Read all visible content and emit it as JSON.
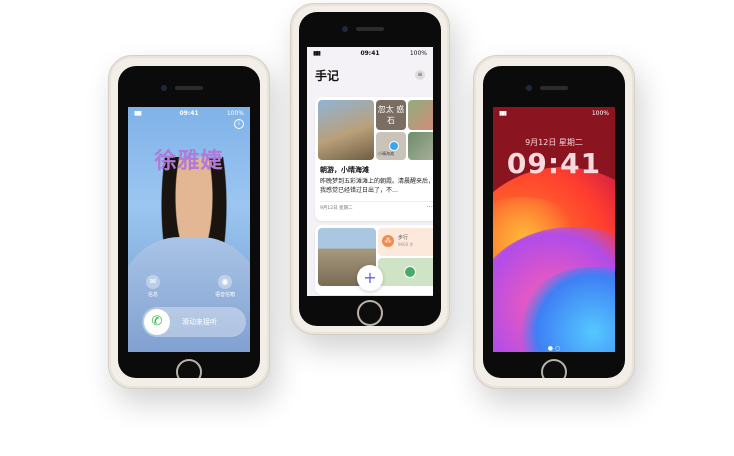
{
  "phone1": {
    "status": {
      "time": "09:41",
      "battery": "100%"
    },
    "contact_name": "徐雅婕",
    "message_label": "信息",
    "voicemail_label": "语音信箱",
    "slider_label": "滑动来接听"
  },
  "phone2": {
    "status": {
      "time": "09:41",
      "battery": "100%"
    },
    "title": "手记",
    "overlay_text": "忽太 惑石",
    "pin_label": "小晴海滩",
    "entry_title": "朝游，小晴海滩",
    "entry_body": "昨晚梦到五彩滩滩上的朝霞。清晨醒来后，我感觉已经错过日出了，不…",
    "entry_date": "9月12日 星期二",
    "walk_label": "步行",
    "walk_value": "9660 步"
  },
  "phone3": {
    "status": {
      "battery": "100%"
    },
    "date": "9月12日 星期二",
    "time": "09:41"
  }
}
